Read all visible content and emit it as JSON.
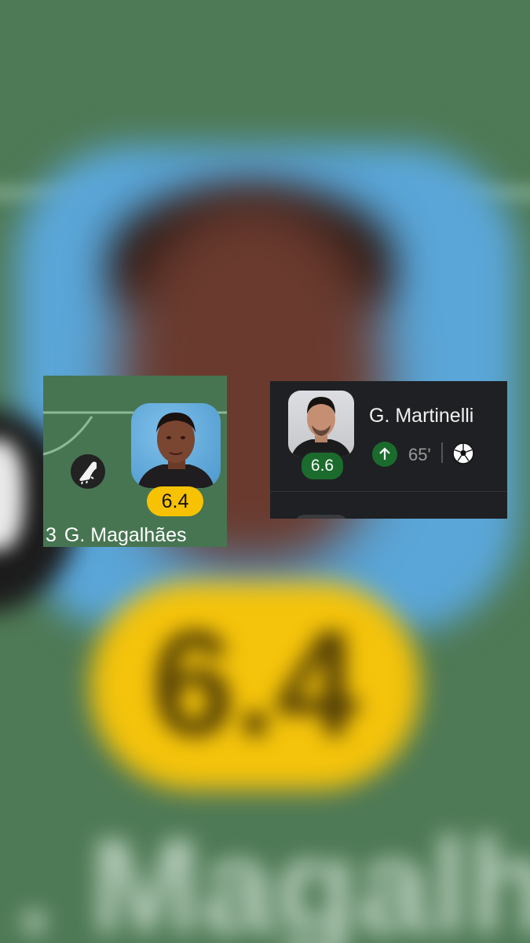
{
  "background": {
    "rating": "6.4",
    "name_fragment": ". Magalh"
  },
  "lineup_card": {
    "player_number": "3",
    "player_name": "G. Magalhães",
    "rating": "6.4",
    "rating_color": "#f7c204",
    "event_icon": "football-boot-icon"
  },
  "player_row": {
    "player_name": "G. Martinelli",
    "rating": "6.6",
    "rating_color": "#1b6b2d",
    "substitution_icon": "arrow-up-icon",
    "minute": "65'",
    "event_icon": "football-icon"
  }
}
